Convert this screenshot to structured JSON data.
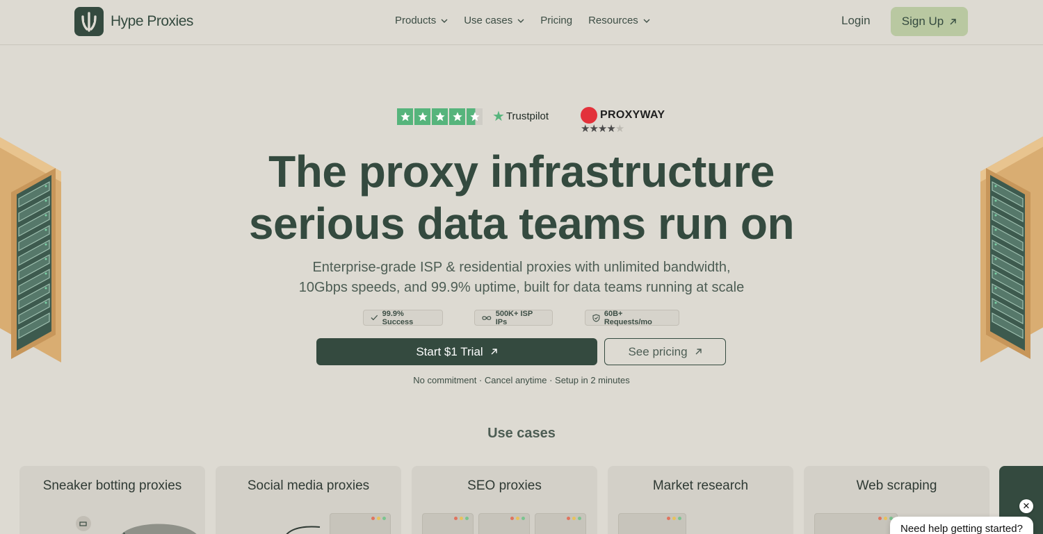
{
  "brand": {
    "name": "Hype Proxies"
  },
  "nav": {
    "items": [
      {
        "label": "Products",
        "has_dropdown": true
      },
      {
        "label": "Use cases",
        "has_dropdown": true
      },
      {
        "label": "Pricing",
        "has_dropdown": false
      },
      {
        "label": "Resources",
        "has_dropdown": true
      }
    ],
    "login": "Login",
    "signup": "Sign Up"
  },
  "ratings": {
    "trustpilot": {
      "name": "Trustpilot",
      "stars": 4.5
    },
    "proxyway": {
      "name": "PROXYWAY",
      "stars": 4
    }
  },
  "hero": {
    "title_line1": "The proxy infrastructure",
    "title_line2": "serious data teams run on",
    "subtitle_line1": "Enterprise-grade ISP & residential proxies with unlimited bandwidth,",
    "subtitle_line2": "10Gbps speeds, and 99.9% uptime, built for data teams running at scale",
    "badges": [
      "99.9% Success",
      "500K+ ISP IPs",
      "60B+ Requests/mo"
    ],
    "primary_cta": "Start $1 Trial",
    "secondary_cta": "See pricing",
    "fineprint": "No commitment · Cancel anytime · Setup in 2 minutes"
  },
  "use_cases": {
    "heading": "Use cases",
    "cards": [
      "Sneaker botting proxies",
      "Social media proxies",
      "SEO proxies",
      "Market research",
      "Web scraping"
    ]
  },
  "chat": {
    "close": "✕",
    "prompt": "Need help getting started?"
  },
  "colors": {
    "background": "#dddad2",
    "primary": "#344a3f",
    "accent": "#b9c8a1",
    "trustpilot_green": "#56b47c",
    "proxyway_red": "#e3323b"
  }
}
